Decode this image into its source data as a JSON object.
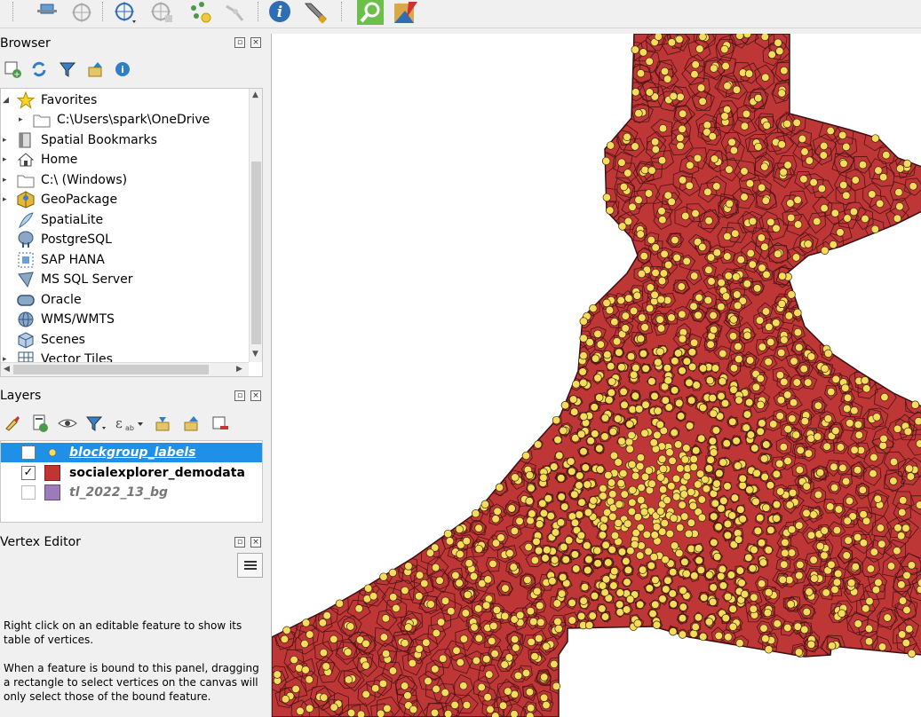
{
  "toolbar": {
    "icons": [
      "pan-map-to-selection-icon",
      "zoom-target-icon",
      "digitize-point-icon",
      "add-feature-icon",
      "vertex-tool-icon",
      "snapping-icon",
      "identify-info-icon",
      "settings-wrench-icon",
      "search-zoom-icon",
      "plugin-icon"
    ]
  },
  "browser": {
    "title": "Browser",
    "items": [
      {
        "label": "Favorites",
        "icon": "star-icon",
        "expanded": true
      },
      {
        "label": "C:\\Users\\spark\\OneDrive",
        "icon": "folder-icon",
        "child": true
      },
      {
        "label": "Spatial Bookmarks",
        "icon": "bookmark-icon"
      },
      {
        "label": "Home",
        "icon": "home-icon"
      },
      {
        "label": "C:\\ (Windows)",
        "icon": "folder-icon"
      },
      {
        "label": "GeoPackage",
        "icon": "geopackage-icon"
      },
      {
        "label": "SpatiaLite",
        "icon": "feather-icon"
      },
      {
        "label": "PostgreSQL",
        "icon": "elephant-icon"
      },
      {
        "label": "SAP HANA",
        "icon": "hana-icon"
      },
      {
        "label": "MS SQL Server",
        "icon": "mssql-icon"
      },
      {
        "label": "Oracle",
        "icon": "oracle-icon"
      },
      {
        "label": "WMS/WMTS",
        "icon": "globe-icon"
      },
      {
        "label": "Scenes",
        "icon": "cube-icon"
      },
      {
        "label": "Vector Tiles",
        "icon": "grid-icon"
      }
    ]
  },
  "layers": {
    "title": "Layers",
    "items": [
      {
        "name": "blockgroup_labels",
        "checked": true,
        "selected": true,
        "swatch": "#f7dc5c",
        "type": "point"
      },
      {
        "name": "socialexplorer_demodata",
        "checked": true,
        "selected": false,
        "swatch": "#c03434",
        "type": "polygon"
      },
      {
        "name": "tl_2022_13_bg",
        "checked": false,
        "selected": false,
        "swatch": "#9b7bb8",
        "type": "polygon"
      }
    ]
  },
  "vertex_editor": {
    "title": "Vertex Editor",
    "text1": "Right click on an editable feature to show its table of vertices.",
    "text2": "When a feature is bound to this panel, dragging a rectangle to select vertices on the canvas will only select those of the bound feature."
  },
  "colors": {
    "polygon_fill": "#bf3636",
    "point_fill": "#f7dc5c",
    "selection": "#1e90e8"
  }
}
